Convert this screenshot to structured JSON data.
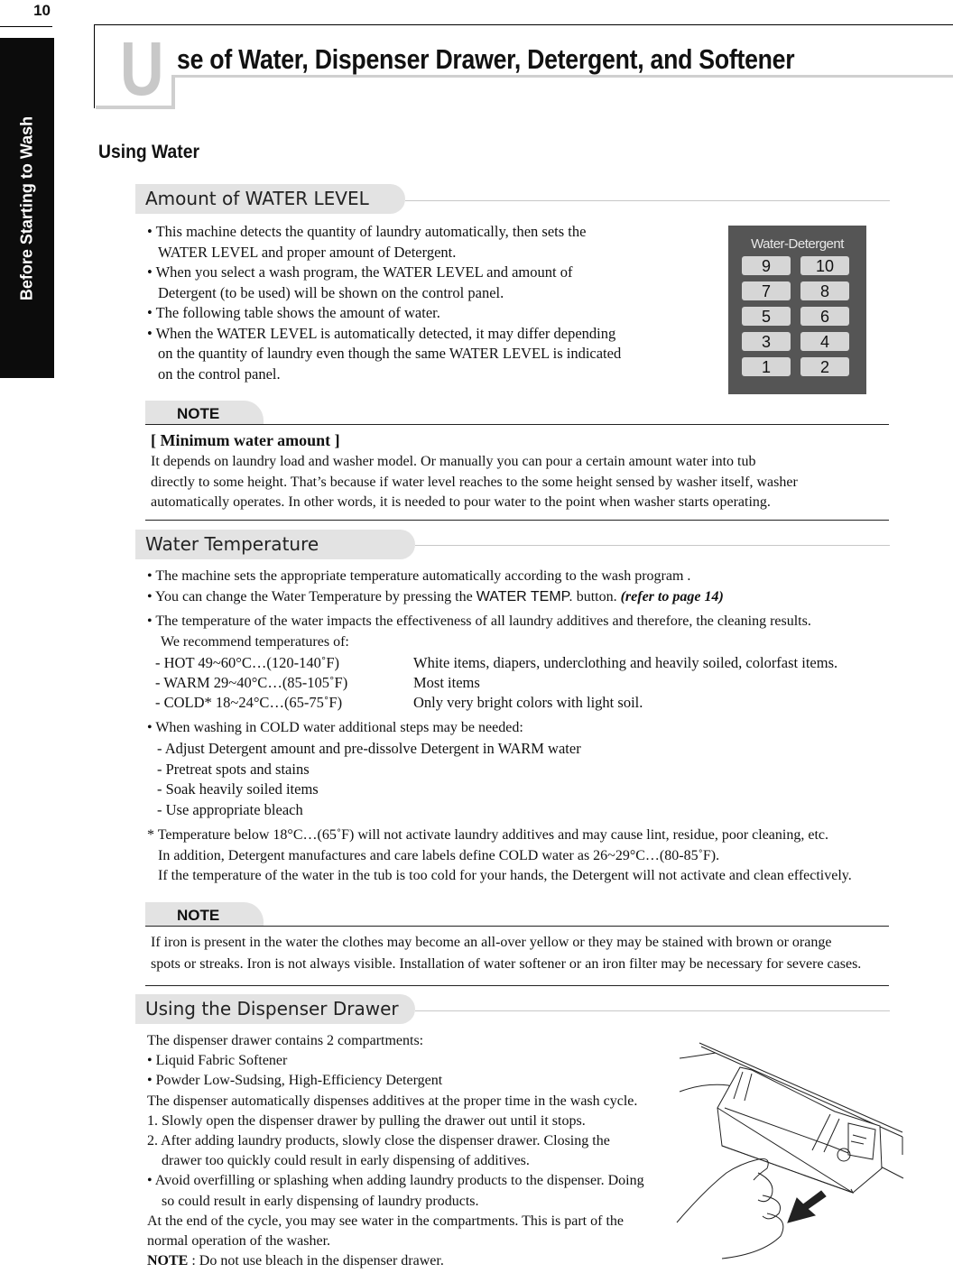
{
  "page_number": "10",
  "side_tab": "Before Starting to Wash",
  "title": {
    "initial": "U",
    "rest": "se of Water, Dispenser Drawer, Detergent, and Softener"
  },
  "section_heading": "Using Water",
  "water_level": {
    "header": "Amount of WATER LEVEL",
    "lines": [
      "• This machine detects the quantity of laundry automatically, then sets the",
      "WATER LEVEL and proper amount of Detergent.",
      "• When you select a wash program, the WATER LEVEL and amount of",
      "Detergent (to be used) will be shown on the control panel.",
      "• The following table shows the amount of water.",
      "• When the WATER LEVEL is automatically detected, it may differ depending",
      "on the quantity of laundry even though the same WATER LEVEL is indicated",
      "on the control panel."
    ],
    "panel": {
      "title": "Water-Detergent",
      "buttons": [
        "9",
        "10",
        "7",
        "8",
        "5",
        "6",
        "3",
        "4",
        "1",
        "2"
      ]
    }
  },
  "note1": {
    "label": "NOTE",
    "heading": "[ Minimum water amount ]",
    "lines": [
      "It depends on laundry load and washer model. Or manually you can pour a certain amount water into tub",
      "directly to some height. That’s because if water level reaches to the some height sensed by washer itself, washer",
      "automatically operates. In other words, it is needed to pour water to the point when washer starts operating."
    ]
  },
  "water_temp": {
    "header": "Water Temperature",
    "line1": "• The machine sets the appropriate temperature automatically according to the wash program .",
    "line2_pre": "• You can change the Water Temperature by pressing the ",
    "line2_button": "WATER TEMP.",
    "line2_post": " button. ",
    "line2_ref": "(refer to page 14)",
    "line3": "•  The temperature of the water impacts the effectiveness of all laundry additives and therefore, the cleaning results.",
    "line4": "We recommend temperatures of:",
    "temps": [
      {
        "range": "- HOT 49~60°C…(120-140˚F)",
        "use": "White items, diapers, underclothing and heavily soiled, colorfast items."
      },
      {
        "range": "- WARM 29~40°C…(85-105˚F)",
        "use": "Most items"
      },
      {
        "range": "- COLD* 18~24°C…(65-75˚F)",
        "use": "Only very bright colors with light soil."
      }
    ],
    "cold_intro": "•  When washing in COLD water additional steps may be needed:",
    "cold_steps": [
      "-  Adjust Detergent amount and pre-dissolve Detergent in WARM water",
      "-  Pretreat spots and stains",
      "-  Soak heavily soiled items",
      "-  Use appropriate bleach"
    ],
    "footnote": [
      "* Temperature below 18°C…(65˚F) will not activate laundry additives and may cause lint, residue, poor cleaning, etc.",
      "In addition, Detergent manufactures and care labels define COLD water as 26~29°C…(80-85˚F).",
      "If the temperature of the water in the tub is too cold for your hands, the Detergent will not activate and clean effectively."
    ]
  },
  "note2": {
    "label": "NOTE",
    "lines": [
      "If iron is present in the water the clothes may become an all-over yellow or they may be stained with brown or orange",
      "spots or streaks. Iron is not always visible. Installation of water softener or an iron filter may be necessary for severe cases."
    ]
  },
  "dispenser": {
    "header": "Using the Dispenser Drawer",
    "lines": [
      "The dispenser drawer contains 2 compartments:",
      "• Liquid Fabric Softener",
      "• Powder Low-Sudsing, High-Efficiency Detergent",
      "The dispenser automatically dispenses additives at the proper time in the wash cycle.",
      "1. Slowly open the dispenser drawer by pulling the drawer out until it stops.",
      "2. After adding laundry products, slowly close the dispenser drawer. Closing the",
      "drawer too quickly could result in early dispensing of additives.",
      "•  Avoid overfilling or splashing when adding laundry products to the dispenser. Doing",
      "so could result in early dispensing of laundry products.",
      "At the end of the cycle, you may see water in the compartments. This is part of the",
      "normal operation of the washer."
    ],
    "note_label": "NOTE",
    "note_text": " : Do not use bleach in the dispenser drawer."
  }
}
